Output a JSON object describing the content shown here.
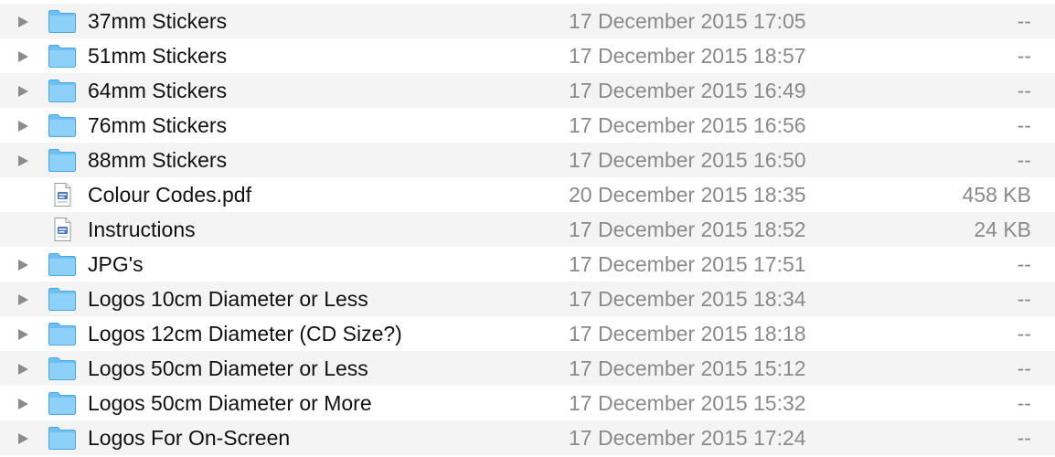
{
  "file_list": {
    "rows": [
      {
        "name": "37mm Stickers",
        "date_modified": "17 December 2015 17:05",
        "size": "--",
        "kind": "folder",
        "icon": "folder-icon"
      },
      {
        "name": "51mm Stickers",
        "date_modified": "17 December 2015 18:57",
        "size": "--",
        "kind": "folder",
        "icon": "folder-icon"
      },
      {
        "name": "64mm Stickers",
        "date_modified": "17 December 2015 16:49",
        "size": "--",
        "kind": "folder",
        "icon": "folder-icon"
      },
      {
        "name": "76mm Stickers",
        "date_modified": "17 December 2015 16:56",
        "size": "--",
        "kind": "folder",
        "icon": "folder-icon"
      },
      {
        "name": "88mm Stickers",
        "date_modified": "17 December 2015 16:50",
        "size": "--",
        "kind": "folder",
        "icon": "folder-icon"
      },
      {
        "name": "Colour Codes.pdf",
        "date_modified": "20 December 2015 18:35",
        "size": "458 KB",
        "kind": "file",
        "icon": "document-icon"
      },
      {
        "name": "Instructions",
        "date_modified": "17 December 2015 18:52",
        "size": "24 KB",
        "kind": "file",
        "icon": "document-icon"
      },
      {
        "name": "JPG's",
        "date_modified": "17 December 2015 17:51",
        "size": "--",
        "kind": "folder",
        "icon": "folder-icon"
      },
      {
        "name": "Logos 10cm Diameter or Less",
        "date_modified": "17 December 2015 18:34",
        "size": "--",
        "kind": "folder",
        "icon": "folder-icon"
      },
      {
        "name": "Logos 12cm Diameter (CD Size?)",
        "date_modified": "17 December 2015 18:18",
        "size": "--",
        "kind": "folder",
        "icon": "folder-icon"
      },
      {
        "name": "Logos 50cm Diameter or Less",
        "date_modified": "17 December 2015 15:12",
        "size": "--",
        "kind": "folder",
        "icon": "folder-icon"
      },
      {
        "name": "Logos 50cm Diameter or More",
        "date_modified": "17 December 2015 15:32",
        "size": "--",
        "kind": "folder",
        "icon": "folder-icon"
      },
      {
        "name": "Logos For On-Screen",
        "date_modified": "17 December 2015 17:24",
        "size": "--",
        "kind": "folder",
        "icon": "folder-icon"
      }
    ]
  },
  "colors": {
    "alt_row_background": "#f4f4f4",
    "folder_blue": "#7ec8f5",
    "secondary_text": "#8a8a8a",
    "primary_text": "#111111"
  }
}
